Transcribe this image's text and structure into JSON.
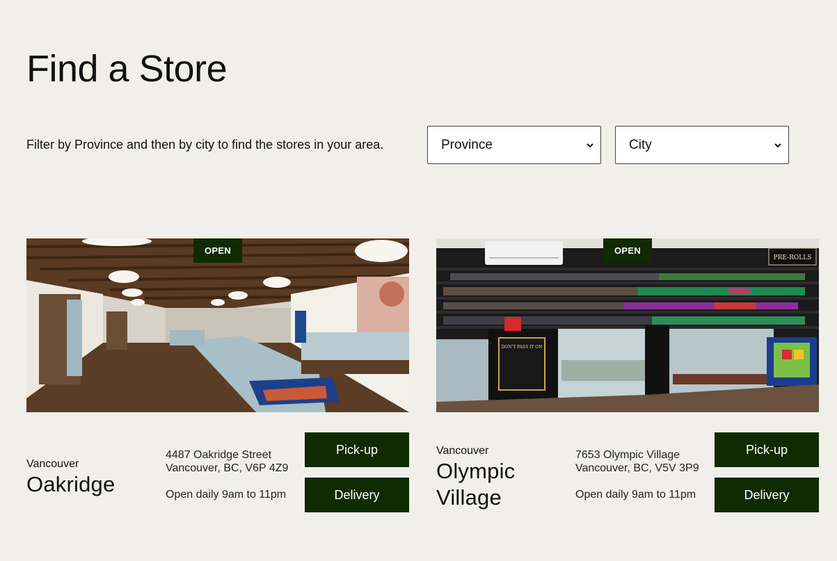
{
  "page": {
    "title": "Find a Store",
    "filter_text": "Filter by Province and then by city to find the stores in your area."
  },
  "filters": {
    "province_value": "Province",
    "city_value": "City"
  },
  "stores": [
    {
      "status": "OPEN",
      "city": "Vancouver",
      "name": "Oakridge",
      "address_line1": "4487 Oakridge Street",
      "address_line2": "Vancouver, BC, V6P 4Z9",
      "hours": "Open daily 9am to 11pm",
      "pickup_label": "Pick-up",
      "delivery_label": "Delivery"
    },
    {
      "status": "OPEN",
      "city": "Vancouver",
      "name": "Olympic Village",
      "address_line1": "7653 Olympic Village",
      "address_line2": "Vancouver, BC, V5V 3P9",
      "hours": "Open daily 9am to 11pm",
      "pickup_label": "Pick-up",
      "delivery_label": "Delivery",
      "shop_sign": "PRE-ROLLS",
      "counter_sign": "DON'T PASS IT ON"
    }
  ],
  "colors": {
    "background": "#f0efe9",
    "button": "#102a02",
    "badge": "#102a02"
  }
}
